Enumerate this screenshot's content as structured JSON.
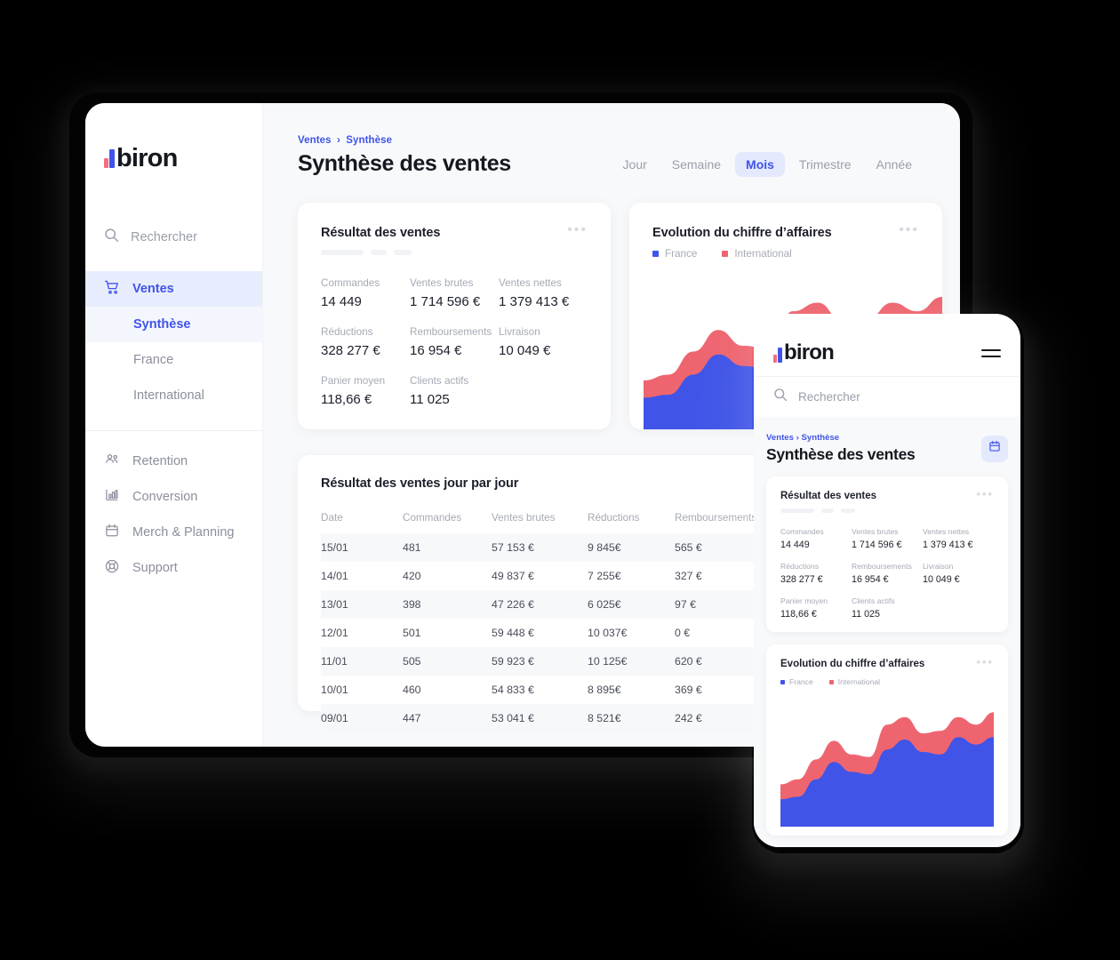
{
  "brand": {
    "name": "biron",
    "blue": "#4054E8",
    "red": "#F2707D"
  },
  "sidebar": {
    "search_placeholder": "Rechercher",
    "items": [
      {
        "label": "Ventes",
        "icon": "cart-icon",
        "active": true
      },
      {
        "label": "Synthèse",
        "sub": true,
        "active": true
      },
      {
        "label": "France",
        "sub": true,
        "active": false
      },
      {
        "label": "International",
        "sub": true,
        "active": false
      },
      {
        "label": "Retention",
        "icon": "users-icon",
        "active": false
      },
      {
        "label": "Conversion",
        "icon": "bar-chart-icon",
        "active": false
      },
      {
        "label": "Merch & Planning",
        "icon": "calendar-icon",
        "active": false
      },
      {
        "label": "Support",
        "icon": "lifebuoy-icon",
        "active": false
      }
    ]
  },
  "header": {
    "breadcrumb_parent": "Ventes",
    "breadcrumb_sep": "›",
    "breadcrumb_current": "Synthèse",
    "title": "Synthèse des ventes",
    "periods": [
      {
        "label": "Jour",
        "active": false
      },
      {
        "label": "Semaine",
        "active": false
      },
      {
        "label": "Mois",
        "active": true
      },
      {
        "label": "Trimestre",
        "active": false
      },
      {
        "label": "Année",
        "active": false
      }
    ]
  },
  "kpi_card": {
    "title": "Résultat des ventes",
    "menu_icon": "ellipsis-icon",
    "metrics": [
      {
        "label": "Commandes",
        "value": "14 449"
      },
      {
        "label": "Ventes brutes",
        "value": "1 714 596 €"
      },
      {
        "label": "Ventes nettes",
        "value": "1 379 413 €"
      },
      {
        "label": "Réductions",
        "value": "328 277 €"
      },
      {
        "label": "Remboursements",
        "value": "16 954 €"
      },
      {
        "label": "Livraison",
        "value": "10 049 €"
      },
      {
        "label": "Panier moyen",
        "value": "118,66 €"
      },
      {
        "label": "Clients actifs",
        "value": "11 025"
      }
    ]
  },
  "chart_card": {
    "title": "Evolution du chiffre d’affaires",
    "menu_icon": "ellipsis-icon",
    "legend": [
      {
        "label": "France",
        "color": "#4054E8"
      },
      {
        "label": "International",
        "color": "#EE6570"
      }
    ]
  },
  "chart_data": {
    "type": "area",
    "title": "Evolution du chiffre d’affaires",
    "stacked": true,
    "xlabel": "",
    "ylabel": "",
    "grid": false,
    "legend_position": "top-left",
    "x": [
      0,
      1,
      2,
      3,
      4,
      5,
      6,
      7,
      8,
      9,
      10,
      11,
      12
    ],
    "series": [
      {
        "name": "France",
        "color": "#4054E8",
        "values": [
          22,
          24,
          38,
          52,
          44,
          42,
          62,
          70,
          60,
          58,
          72,
          66,
          72
        ]
      },
      {
        "name": "International",
        "color": "#EE6570",
        "values": [
          12,
          14,
          16,
          17,
          14,
          14,
          20,
          18,
          15,
          19,
          16,
          16,
          20
        ]
      }
    ],
    "ylim": [
      0,
      100
    ]
  },
  "table_card": {
    "title": "Résultat des ventes jour par jour",
    "columns": [
      "Date",
      "Commandes",
      "Ventes brutes",
      "Réductions",
      "Remboursements"
    ],
    "rows": [
      [
        "15/01",
        "481",
        "57 153 €",
        "9 845€",
        "565 €"
      ],
      [
        "14/01",
        "420",
        "49 837 €",
        "7 255€",
        "327 €"
      ],
      [
        "13/01",
        "398",
        "47 226 €",
        "6 025€",
        "97 €"
      ],
      [
        "12/01",
        "501",
        "59 448 €",
        "10 037€",
        "0 €"
      ],
      [
        "11/01",
        "505",
        "59 923 €",
        "10 125€",
        "620 €"
      ],
      [
        "10/01",
        "460",
        "54 833 €",
        "8 895€",
        "369 €"
      ],
      [
        "09/01",
        "447",
        "53 041 €",
        "8 521€",
        "242 €"
      ]
    ]
  },
  "phone": {
    "brand": "biron",
    "menu_icon": "hamburger-icon",
    "search_placeholder": "Rechercher",
    "breadcrumb_parent": "Ventes",
    "breadcrumb_sep": "›",
    "breadcrumb_current": "Synthèse",
    "title": "Synthèse des ventes",
    "calendar_icon": "calendar-icon",
    "kpi_card": {
      "title": "Résultat des ventes",
      "metrics": [
        {
          "label": "Commandes",
          "value": "14 449"
        },
        {
          "label": "Ventes brutes",
          "value": "1 714 596 €"
        },
        {
          "label": "Ventes nettes",
          "value": "1 379 413 €"
        },
        {
          "label": "Réductions",
          "value": "328 277 €"
        },
        {
          "label": "Remboursements",
          "value": "16 954 €"
        },
        {
          "label": "Livraison",
          "value": "10 049 €"
        },
        {
          "label": "Panier moyen",
          "value": "118,66 €"
        },
        {
          "label": "Clients actifs",
          "value": "11 025"
        }
      ]
    },
    "chart_card": {
      "title": "Evolution du chiffre d’affaires",
      "legend": [
        {
          "label": "France",
          "color": "#4054E8"
        },
        {
          "label": "International",
          "color": "#EE6570"
        }
      ]
    }
  }
}
